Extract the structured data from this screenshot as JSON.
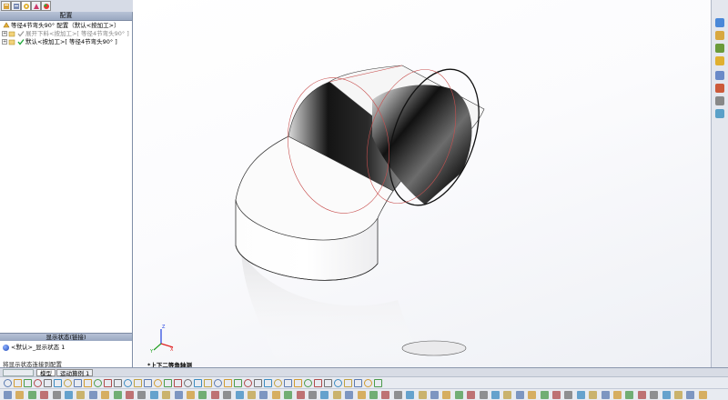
{
  "config_panel": {
    "header": "配置",
    "tree": [
      {
        "label": "等径4节弯头90° 配置（默认<按加工>）"
      },
      {
        "label": "展开下料<按加工>[ 等径4节弯头90° ]"
      },
      {
        "label": "默认<按加工>[ 等径4节弯头90° ]"
      }
    ]
  },
  "display_state_panel": {
    "header": "显示状态(链接)",
    "item": "<默认>_显示状态 1",
    "link_note": "将显示状态连接到配置"
  },
  "viewport": {
    "orientation_label": "*上下二等角轴测",
    "axis_labels": {
      "x": "X",
      "y": "Y",
      "z": "Z"
    }
  },
  "bottom_tabs": [
    {
      "label": "模型",
      "active": true
    },
    {
      "label": "运动算例 1",
      "active": false
    }
  ],
  "colors": {
    "panel_header": "#9aa8c1",
    "edge_highlight": "#c8504f",
    "axis_x": "#e02020",
    "axis_y": "#20a020",
    "axis_z": "#2040e0"
  },
  "icons": [
    "feature-manager-icon",
    "property-manager-icon",
    "configuration-manager-icon",
    "appearance-icon",
    "check-icon",
    "part-icon"
  ]
}
